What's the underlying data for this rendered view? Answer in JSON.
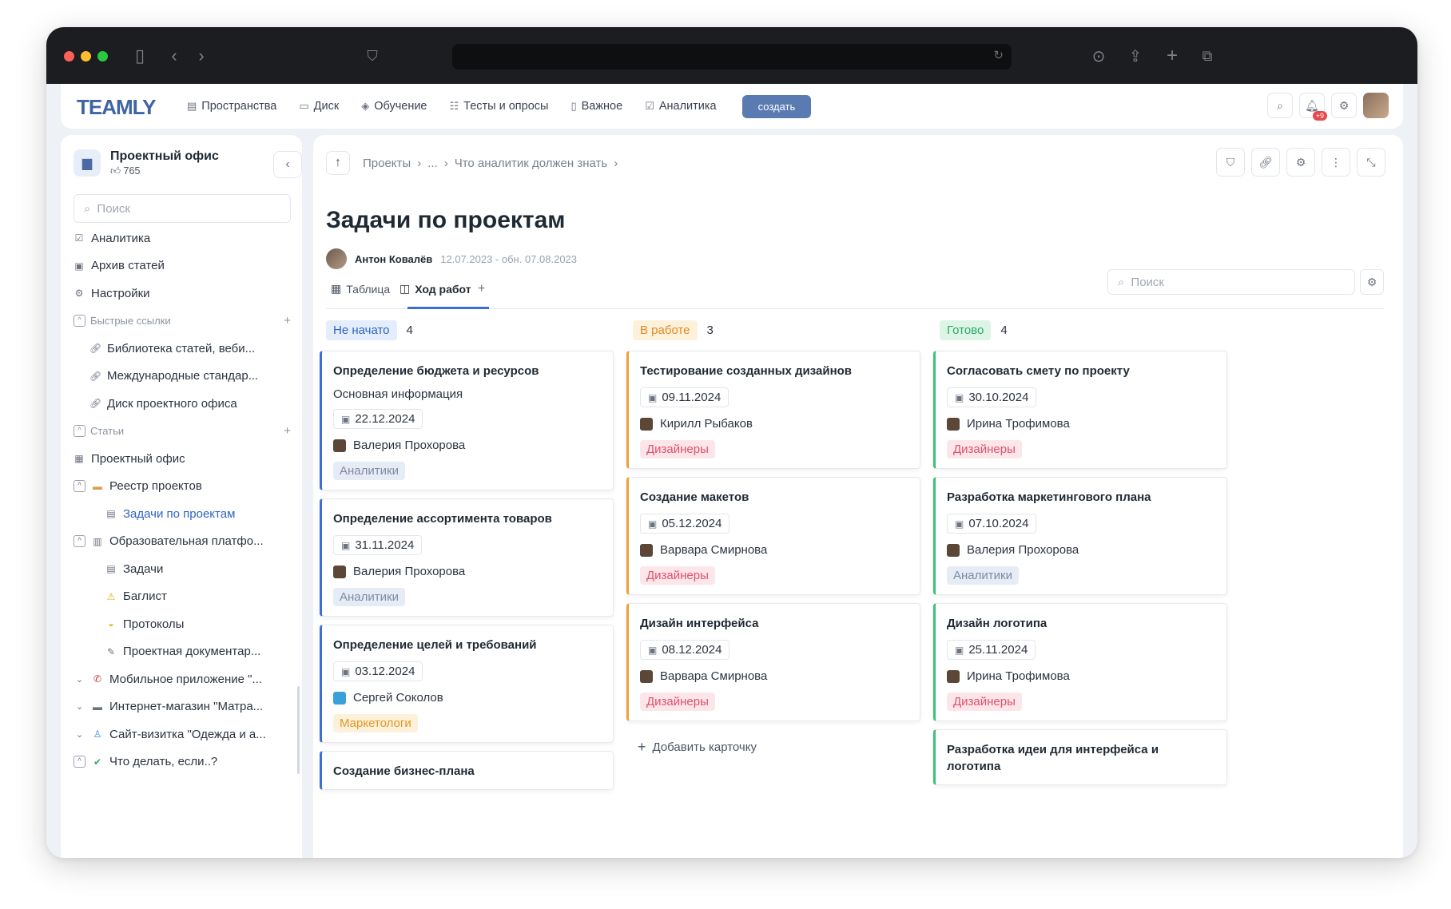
{
  "app": {
    "logo": "TEAMLY"
  },
  "nav": {
    "items": [
      {
        "label": "Пространства",
        "icon": "spaces-icon"
      },
      {
        "label": "Диск",
        "icon": "folder-icon"
      },
      {
        "label": "Обучение",
        "icon": "education-icon"
      },
      {
        "label": "Тесты и опросы",
        "icon": "tests-icon"
      },
      {
        "label": "Важное",
        "icon": "bookmark-icon"
      },
      {
        "label": "Аналитика",
        "icon": "analytics-icon"
      }
    ],
    "create_label": "создать",
    "notif_badge": "+9"
  },
  "sidebar": {
    "space_title": "Проектный офис",
    "space_likes": "765",
    "search_placeholder": "Поиск",
    "items": [
      {
        "label": "Аналитика",
        "type": "link",
        "indent": 0,
        "icon": "analytics-icon"
      },
      {
        "label": "Архив статей",
        "type": "link",
        "indent": 0,
        "icon": "archive-icon"
      },
      {
        "label": "Настройки",
        "type": "link",
        "indent": 0,
        "icon": "gear-icon"
      },
      {
        "label": "Быстрые ссылки",
        "type": "section"
      },
      {
        "label": "Библиотека статей, веби...",
        "type": "link",
        "indent": 1,
        "icon": "link-icon"
      },
      {
        "label": "Международные стандар...",
        "type": "link",
        "indent": 1,
        "icon": "link-icon"
      },
      {
        "label": "Диск проектного офиса",
        "type": "link",
        "indent": 1,
        "icon": "link-icon"
      },
      {
        "label": "Статьи",
        "type": "section"
      },
      {
        "label": "Проектный офис",
        "type": "link",
        "indent": 0,
        "icon": "building-icon"
      },
      {
        "label": "Реестр проектов",
        "type": "tree",
        "indent": 0,
        "icon": "folder-icon"
      },
      {
        "label": "Задачи по проектам",
        "type": "active",
        "indent": 2,
        "icon": "board-icon"
      },
      {
        "label": "Образовательная платфо...",
        "type": "tree",
        "indent": 0,
        "icon": "books-icon"
      },
      {
        "label": "Задачи",
        "type": "link",
        "indent": 2,
        "icon": "board-icon"
      },
      {
        "label": "Баглист",
        "type": "link",
        "indent": 2,
        "icon": "warning-icon"
      },
      {
        "label": "Протоколы",
        "type": "link",
        "indent": 2,
        "icon": "coin-icon"
      },
      {
        "label": "Проектная документар...",
        "type": "link",
        "indent": 2,
        "icon": "memo-icon"
      },
      {
        "label": "Мобильное приложение \"...",
        "type": "tree-open",
        "indent": 0,
        "icon": "phone-icon"
      },
      {
        "label": "Интернет-магазин \"Матра...",
        "type": "tree-open",
        "indent": 0,
        "icon": "bed-icon"
      },
      {
        "label": "Сайт-визитка \"Одежда и а...",
        "type": "tree-open",
        "indent": 0,
        "icon": "shirt-icon"
      },
      {
        "label": "Что делать, если..?",
        "type": "tree",
        "indent": 0,
        "icon": "check-icon"
      }
    ]
  },
  "main": {
    "breadcrumb": [
      "Проекты",
      "...",
      "Что аналитик должен знать"
    ],
    "title": "Задачи по проектам",
    "author": "Антон Ковалёв",
    "dates": "12.07.2023 - обн. 07.08.2023",
    "tabs": [
      {
        "label": "Таблица"
      },
      {
        "label": "Ход работ"
      }
    ],
    "board_search_placeholder": "Поиск",
    "add_card_label": "Добавить карточку"
  },
  "columns": [
    {
      "name": "Не начато",
      "count": "4",
      "color": "#3b6fd6",
      "bg": "#e4edfb",
      "fg": "#2f63c4",
      "cards": [
        {
          "title": "Определение бюджета и ресурсов",
          "subtitle": "Основная информация",
          "date": "22.12.2024",
          "person": "Валерия Прохорова",
          "tag": "Аналитики",
          "tag_color": "analytics"
        },
        {
          "title": "Определение ассортимента товаров",
          "date": "31.11.2024",
          "person": "Валерия Прохорова",
          "tag": "Аналитики",
          "tag_color": "analytics"
        },
        {
          "title": "Определение целей и требований",
          "date": "03.12.2024",
          "person": "Сергей Соколов",
          "tag": "Маркетологи",
          "tag_color": "marketing"
        },
        {
          "title": "Создание бизнес-плана"
        }
      ]
    },
    {
      "name": "В работе",
      "count": "3",
      "color": "#f0a03a",
      "bg": "#fdf1dc",
      "fg": "#e08a1e",
      "cards": [
        {
          "title": "Тестирование созданных дизайнов",
          "date": "09.11.2024",
          "person": "Кирилл Рыбаков",
          "tag": "Дизайнеры",
          "tag_color": "design"
        },
        {
          "title": "Создание макетов",
          "date": "05.12.2024",
          "person": "Варвара Смирнова",
          "tag": "Дизайнеры",
          "tag_color": "design"
        },
        {
          "title": "Дизайн интерфейса",
          "date": "08.12.2024",
          "person": "Варвара Смирнова",
          "tag": "Дизайнеры",
          "tag_color": "design"
        }
      ]
    },
    {
      "name": "Готово",
      "count": "4",
      "color": "#3cc07a",
      "bg": "#ddf5e6",
      "fg": "#2ea866",
      "cards": [
        {
          "title": "Согласовать смету по проекту",
          "date": "30.10.2024",
          "person": "Ирина Трофимова",
          "tag": "Дизайнеры",
          "tag_color": "design"
        },
        {
          "title": "Разработка маркетингового плана",
          "date": "07.10.2024",
          "person": "Валерия Прохорова",
          "tag": "Аналитики",
          "tag_color": "analytics"
        },
        {
          "title": "Дизайн логотипа",
          "date": "25.11.2024",
          "person": "Ирина Трофимова",
          "tag": "Дизайнеры",
          "tag_color": "design"
        },
        {
          "title": "Разработка идеи для интерфейса и логотипа"
        }
      ]
    }
  ],
  "tag_colors": {
    "analytics": {
      "bg": "#e6ecf5",
      "fg": "#7d8aa3"
    },
    "design": {
      "bg": "#fde6ea",
      "fg": "#e0506b"
    },
    "marketing": {
      "bg": "#fdf1dc",
      "fg": "#e5961f"
    }
  }
}
